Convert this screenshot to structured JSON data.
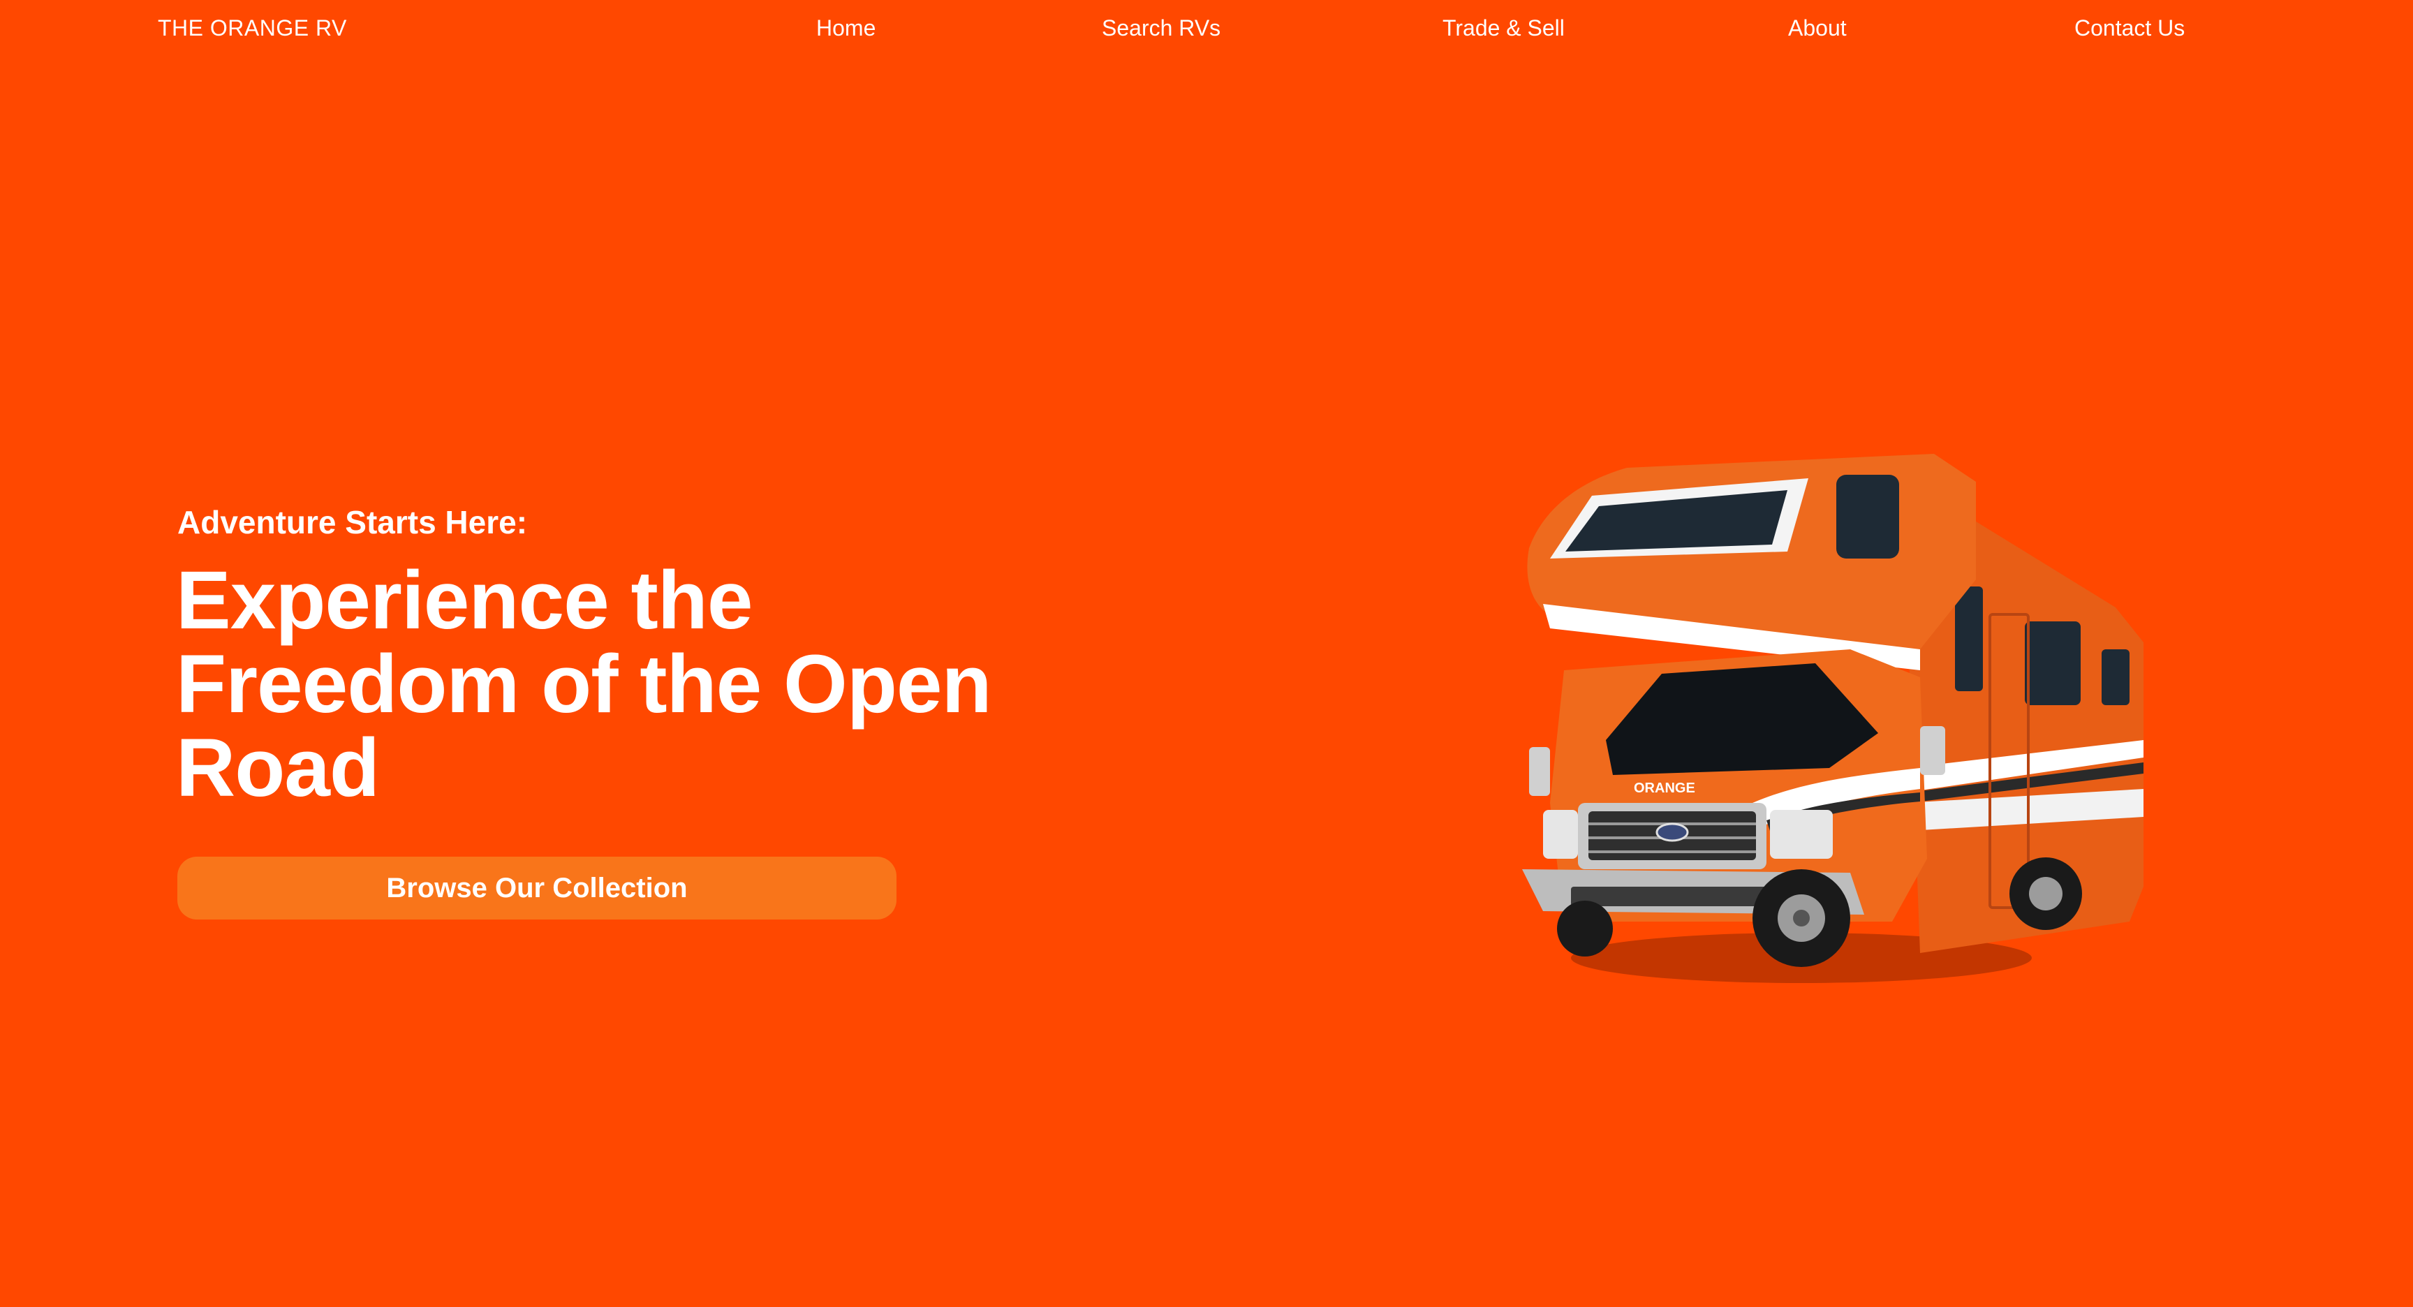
{
  "header": {
    "brand": "THE ORANGE RV",
    "nav": [
      "Home",
      "Search RVs",
      "Trade & Sell",
      "About",
      "Contact Us"
    ]
  },
  "hero": {
    "eyebrow": "Adventure Starts Here:",
    "headline": "Experience the Freedom of the Open Road",
    "cta_label": "Browse Our Collection",
    "vehicle_badge": "ORANGE"
  },
  "colors": {
    "background": "#FF4800",
    "cta": "#F9751A",
    "text": "#FFFFFF"
  },
  "icons": {
    "hero_image": "motorhome-rv-illustration"
  }
}
